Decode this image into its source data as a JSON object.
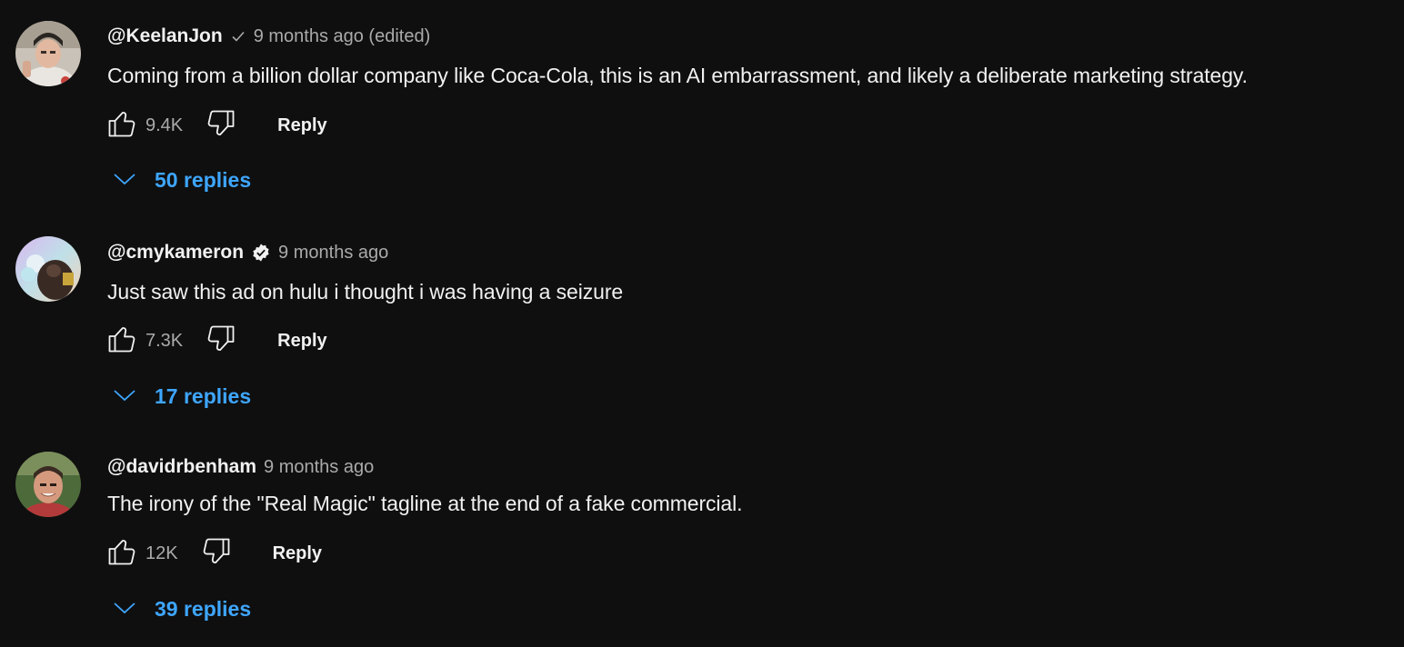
{
  "comments": [
    {
      "author": "@KeelanJon",
      "badge": "checkmark-icon",
      "time": "9 months ago (edited)",
      "text": "Coming from a billion dollar company like Coca-Cola, this is an AI embarrassment, and likely a deliberate marketing strategy.",
      "likes": "9.4K",
      "reply_label": "Reply",
      "replies_label": "50 replies"
    },
    {
      "author": "@cmykameron",
      "badge": "verified-icon",
      "time": "9 months ago",
      "text": "Just saw this ad on hulu i thought i was having a seizure",
      "likes": "7.3K",
      "reply_label": "Reply",
      "replies_label": "17 replies"
    },
    {
      "author": "@davidrbenham",
      "badge": "",
      "time": "9 months ago",
      "text": "The irony of the \"Real Magic\" tagline at the end of a fake commercial.",
      "likes": "12K",
      "reply_label": "Reply",
      "replies_label": "39 replies"
    }
  ],
  "colors": {
    "background": "#0f0f0f",
    "primary_text": "#f1f1f1",
    "secondary_text": "#aaaaaa",
    "link_blue": "#3ea6ff"
  },
  "icons": [
    "thumbs-up-icon",
    "thumbs-down-icon",
    "chevron-down-icon",
    "checkmark-icon",
    "verified-icon"
  ]
}
